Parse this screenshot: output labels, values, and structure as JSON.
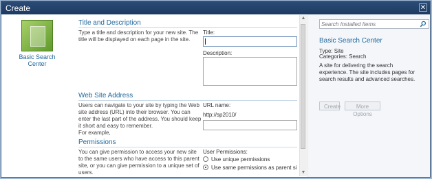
{
  "dialog": {
    "title": "Create",
    "close_glyph": "✕"
  },
  "template": {
    "label": "Basic Search Center"
  },
  "sections": {
    "title_desc": {
      "heading": "Title and Description",
      "description": "Type a title and description for your new site. The title will be displayed on each page in the site.",
      "title_label": "Title:",
      "title_value": "",
      "description_label": "Description:",
      "description_value": ""
    },
    "address": {
      "heading": "Web Site Address",
      "description": "Users can navigate to your site by typing the Web site address (URL) into their browser. You can enter the last part of the address. You should keep it short and easy to remember.",
      "example": "For example,",
      "url_label": "URL name:",
      "url_prefix": "http://sp2010/",
      "url_value": ""
    },
    "permissions": {
      "heading": "Permissions",
      "description": "You can give permission to access your new site to the same users who have access to this parent site, or you can give permission to a unique set of users.",
      "label": "User Permissions:",
      "options": [
        "Use unique permissions",
        "Use same permissions as parent si"
      ],
      "selected_index": 1
    }
  },
  "sidebar": {
    "search_placeholder": "Search Installed Items",
    "name": "Basic Search Center",
    "type": "Type: Site",
    "categories": "Categories: Search",
    "description": "A site for delivering the search experience. The site includes pages for search results and advanced searches.",
    "create_label": "Create",
    "more_label": "More Options"
  },
  "colors": {
    "titlebar": "#1c3a61",
    "link": "#21699d"
  }
}
